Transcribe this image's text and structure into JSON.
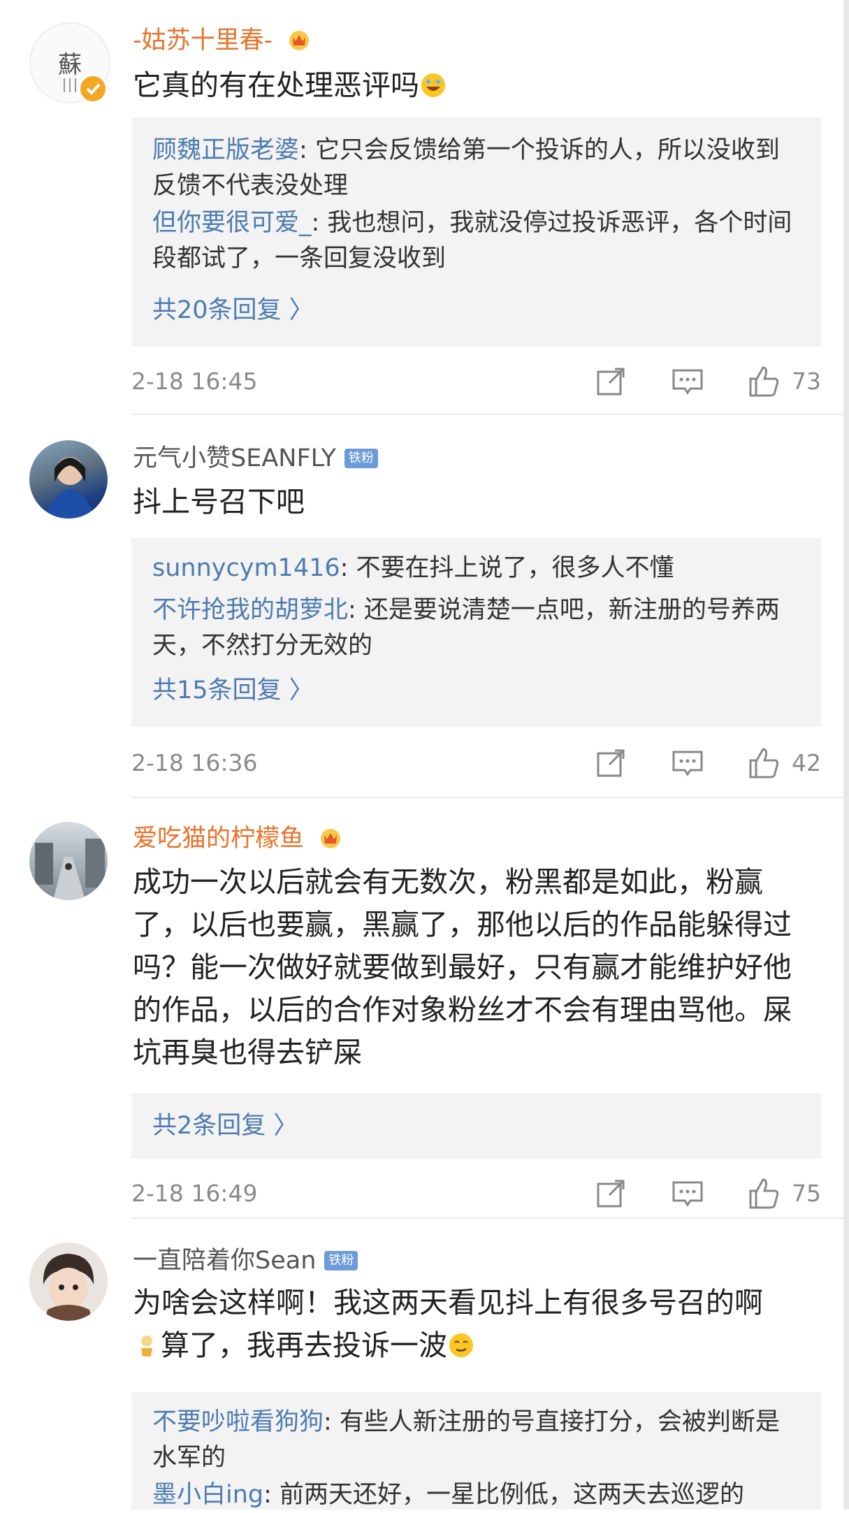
{
  "comments": [
    {
      "user": "-姑苏十里春-",
      "text": "它真的有在处理恶评吗",
      "replies": [
        {
          "name": "顾魏正版老婆",
          "text": ": 它只会反馈给第一个投诉的人，所以没收到反馈不代表没处理"
        },
        {
          "name": "但你要很可爱_",
          "text": ": 我也想问，我就没停过投诉恶评，各个时间段都试了，一条回复没收到"
        }
      ],
      "more": "共20条回复 〉",
      "time": "2-18 16:45",
      "likes": "73"
    },
    {
      "user": "元气小赞SEANFLY",
      "badge": "铁粉",
      "text": "抖上号召下吧",
      "replies": [
        {
          "name": "sunnycym1416",
          "text": ": 不要在抖上说了，很多人不懂"
        },
        {
          "name": "不许抢我的胡萝北",
          "text": ": 还是要说清楚一点吧，新注册的号养两天，不然打分无效的"
        }
      ],
      "more": "共15条回复 〉",
      "time": "2-18 16:36",
      "likes": "42"
    },
    {
      "user": "爱吃猫的柠檬鱼",
      "text": "成功一次以后就会有无数次，粉黑都是如此，粉赢了，以后也要赢，黑赢了，那他以后的作品能躲得过吗？能一次做好就要做到最好，只有赢才能维护好他的作品，以后的合作对象粉丝才不会有理由骂他。屎坑再臭也得去铲屎",
      "more": "共2条回复 〉",
      "time": "2-18 16:49",
      "likes": "75"
    },
    {
      "user": "一直陪着你Sean",
      "badge": "铁粉",
      "text_line1": "为啥会这样啊！我这两天看见抖上有很多号召的啊",
      "text_line2": "算了，我再去投诉一波",
      "replies": [
        {
          "name": "不要吵啦看狗狗",
          "text": ": 有些人新注册的号直接打分，会被判断是水军的"
        },
        {
          "name": "墨小白ing",
          "text": ": 前两天还好，一星比例低，这两天去巡逻的"
        }
      ]
    }
  ],
  "colors": {
    "accent_gold": "#e8732b",
    "link_blue": "#4e7bb0",
    "fan_badge": "#6b9bd9"
  }
}
